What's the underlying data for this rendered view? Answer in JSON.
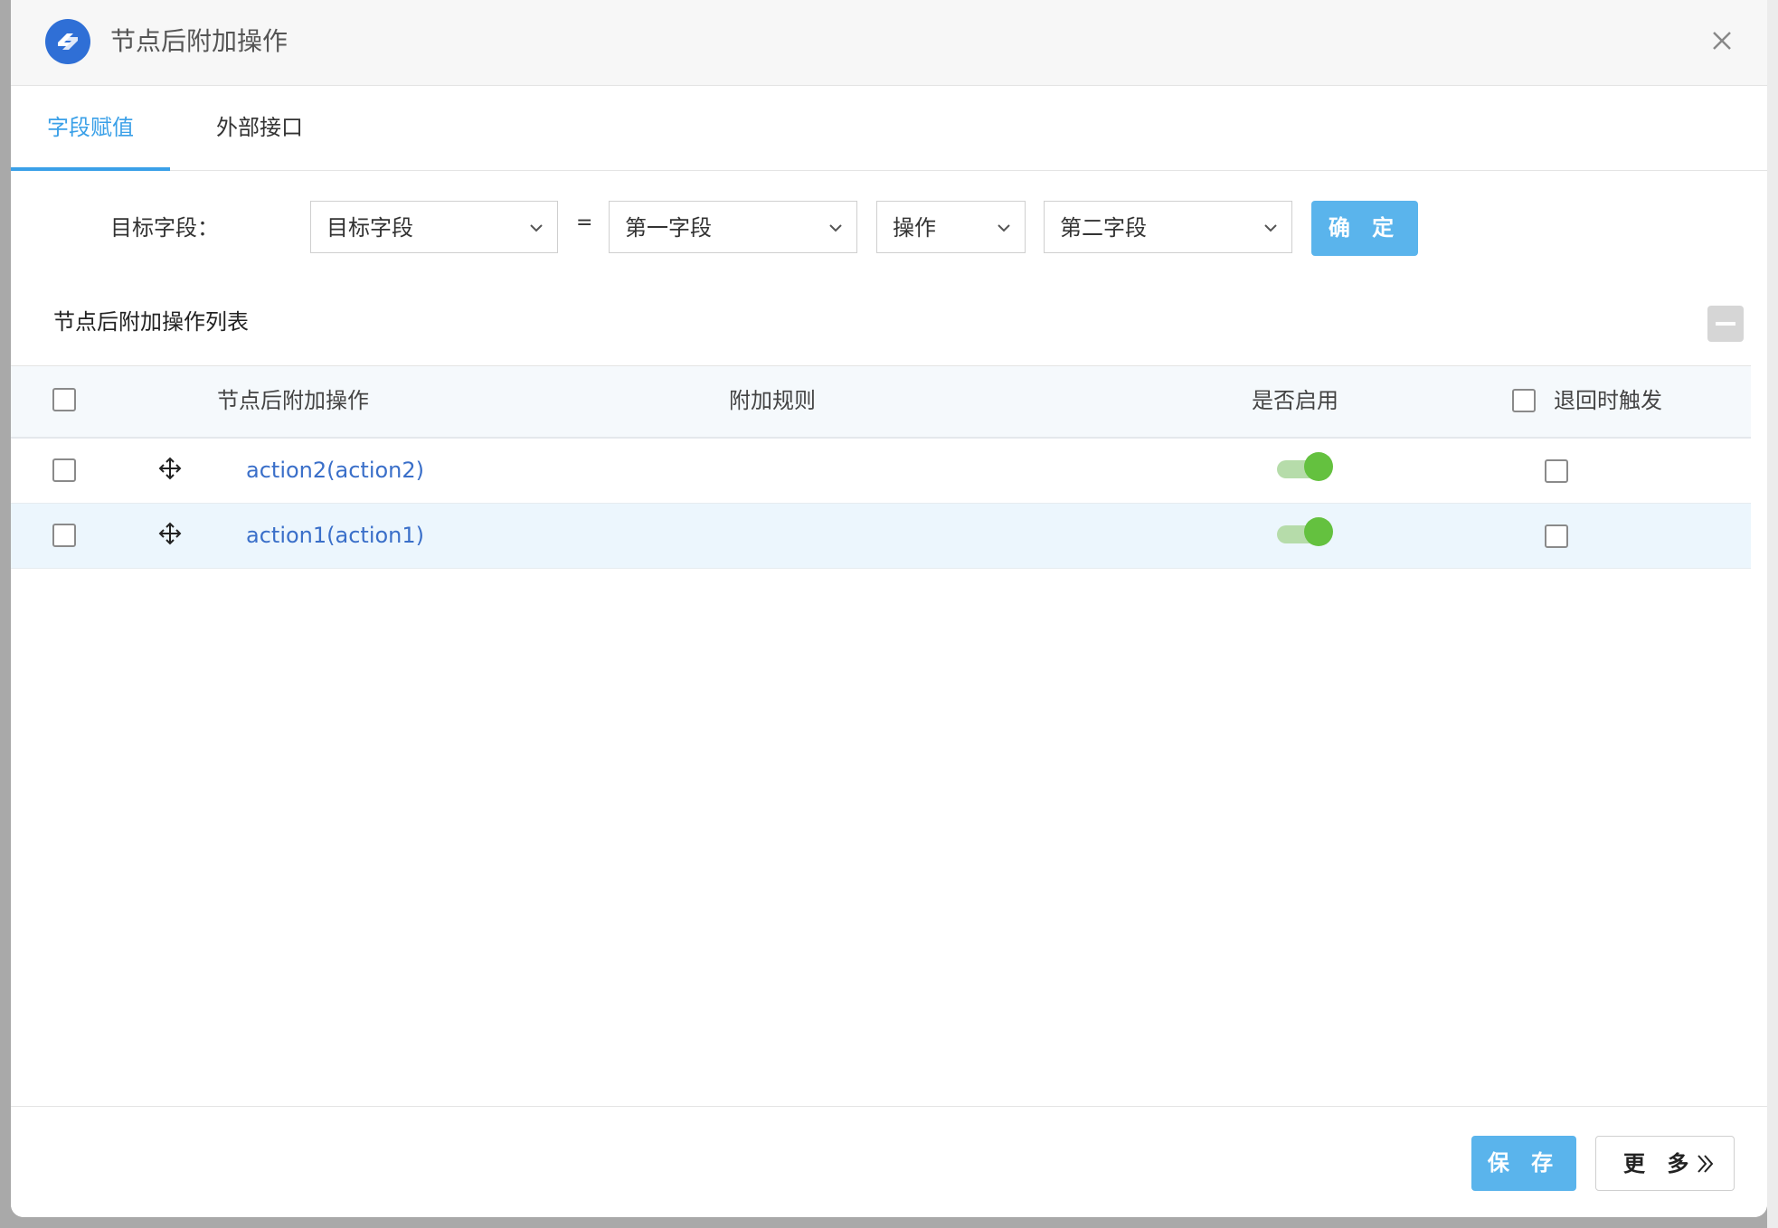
{
  "dialog": {
    "title": "节点后附加操作"
  },
  "tabs": [
    {
      "label": "字段赋值",
      "active": true
    },
    {
      "label": "外部接口",
      "active": false
    }
  ],
  "form": {
    "label": "目标字段：",
    "target_field": "目标字段",
    "equals": "=",
    "first_field": "第一字段",
    "operation": "操作",
    "second_field": "第二字段",
    "confirm_label": "确 定"
  },
  "section": {
    "title": "节点后附加操作列表"
  },
  "table": {
    "headers": {
      "action": "节点后附加操作",
      "rule": "附加规则",
      "enabled": "是否启用",
      "rollback": "退回时触发"
    },
    "rows": [
      {
        "action": "action2(action2)",
        "rule": "",
        "enabled": true,
        "rollback": false
      },
      {
        "action": "action1(action1)",
        "rule": "",
        "enabled": true,
        "rollback": false
      }
    ]
  },
  "footer": {
    "save_label": "保 存",
    "more_label": "更 多"
  },
  "colors": {
    "primary": "#5ab4ec",
    "tab_active": "#3aa0e8",
    "link": "#3a6fc9",
    "toggle_on": "#64c13f",
    "row_highlight": "#ecf6fd"
  },
  "icons": [
    "app-logo-icon",
    "close-icon",
    "chevron-down-icon",
    "move-icon",
    "double-chevron-right-icon"
  ]
}
